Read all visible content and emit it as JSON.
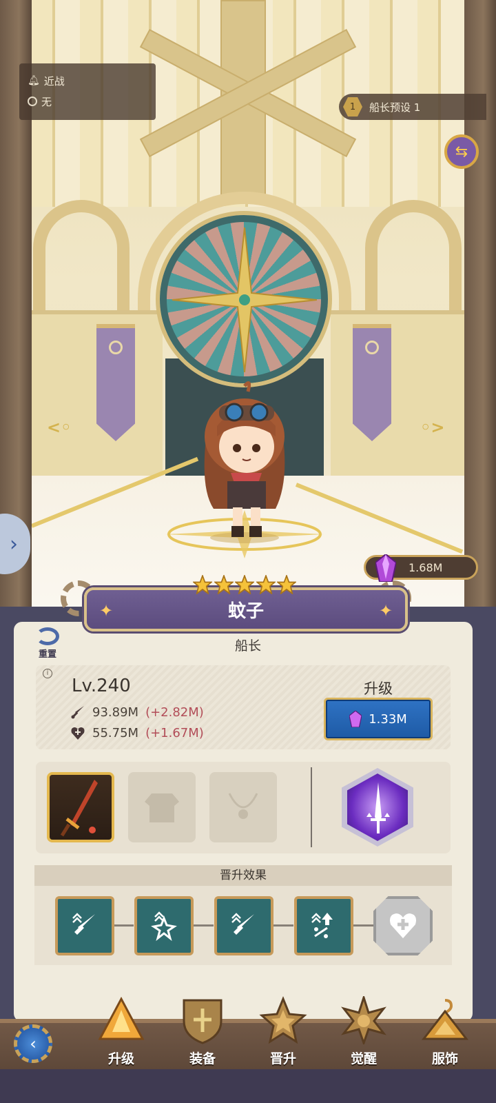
{
  "hud": {
    "attack_type": "近战",
    "element": "无",
    "preset_number": "1",
    "preset_label": "船长预设 1",
    "crystal_amount": "1.68M"
  },
  "hero": {
    "name": "蚊子",
    "stars": 5,
    "role": "船长",
    "level": "Lv.240",
    "attack": "93.89M",
    "attack_bonus": "(+2.82M)",
    "hp": "55.75M",
    "hp_bonus": "(+1.67M)"
  },
  "upgrade": {
    "label": "升级",
    "cost": "1.33M"
  },
  "reset_label": "重置",
  "promotion": {
    "title": "晋升效果",
    "effects": [
      "attack-up",
      "crit-up",
      "attack-up",
      "crit-damage-up",
      "hp-up-locked"
    ]
  },
  "nav": {
    "items": [
      "升级",
      "装备",
      "晋升",
      "觉醒",
      "服饰"
    ]
  },
  "colors": {
    "accent_gold": "#d9b45c",
    "upgrade_blue": "#2f73c4",
    "bonus_red": "#b24d58",
    "plate_purple": "#6f5f92"
  }
}
